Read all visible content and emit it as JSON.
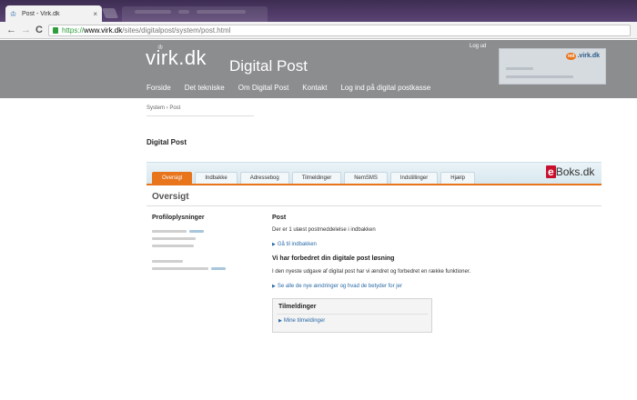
{
  "browser": {
    "tab_title": "Post - Virk.dk",
    "tab_close": "×",
    "url_scheme": "https://",
    "url_host": "www.virk.dk",
    "url_path": "/sites/digitalpost/system/post.html",
    "back_icon": "←",
    "forward_icon": "→",
    "reload_icon": "C"
  },
  "header": {
    "logo": "virk.dk",
    "logo_crown": "♔",
    "site_title": "Digital Post",
    "logout": "Log ud",
    "login_box_logo_prefix": "mit",
    "login_box_logo": ".virk.dk",
    "nav": [
      "Forside",
      "Det tekniske",
      "Om Digital Post",
      "Kontakt",
      "Log ind på digital postkasse"
    ]
  },
  "content": {
    "breadcrumb": "System › Post",
    "page_title": "Digital Post",
    "eboks_e": "e",
    "eboks_text": "Boks.dk",
    "tabs": [
      "Oversigt",
      "Indbakke",
      "Adressebog",
      "Tilmeldinger",
      "NemSMS",
      "Indstillinger",
      "Hjælp"
    ],
    "active_tab": "Oversigt",
    "section_title": "Oversigt",
    "profile_heading": "Profiloplysninger",
    "post_heading": "Post",
    "post_text": "Der er 1 ulæst postmeddelelse i indbakken",
    "inbox_link": "Gå til indbakken",
    "improve_heading": "Vi har forbedret din digitale post løsning",
    "improve_text": "I den nyeste udgave af digital post har vi ændret og forbedret en række funktioner.",
    "changes_link": "Se alle de nye ændringer og hvad de betyder for jer",
    "subscriptions_heading": "Tilmeldinger",
    "subscriptions_link": "Mine tilmeldinger",
    "link_arrow": "▶"
  },
  "colors": {
    "header_gray": "#8b8d8e",
    "accent_orange": "#e8741b",
    "link_blue": "#2a6aa8"
  }
}
